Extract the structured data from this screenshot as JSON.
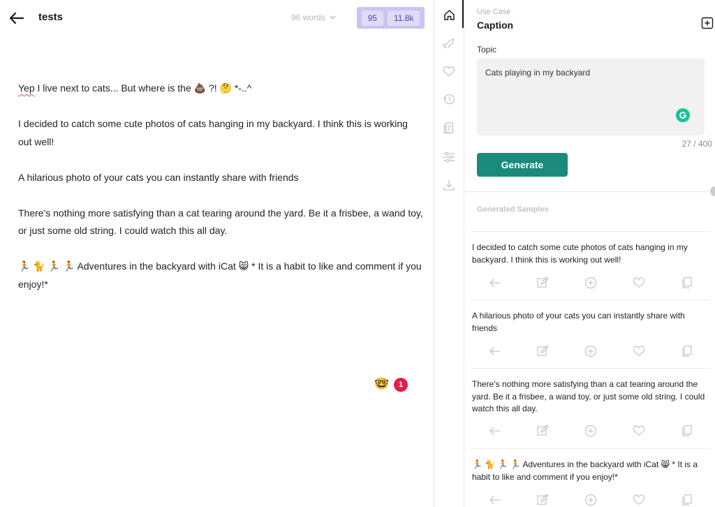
{
  "editor": {
    "title": "tests",
    "word_count": "96 words",
    "score": "95",
    "chars": "11.8k",
    "paragraphs": [
      {
        "squiggle": "Yep",
        "rest": " I live next to cats... But where is the 💩 ?! 🤔 *-..^"
      },
      {
        "text": "I decided to catch some cute photos of cats hanging in my backyard. I think this is working out well!"
      },
      {
        "text": "A hilarious photo of your cats you can instantly share with friends"
      },
      {
        "text": "There's nothing more satisfying than a cat tearing around the yard. Be it a frisbee, a wand toy, or just some old string. I could watch this all day."
      },
      {
        "text": "🏃 🐈 🏃 🏃 Adventures in the backyard with iCat 😸 * It is a habit to like and comment if you enjoy!*"
      }
    ],
    "float_emoji": "🤓",
    "alert_count": "1"
  },
  "rail": {
    "items": [
      "home-icon",
      "rocket-icon",
      "heart-icon",
      "history-icon",
      "document-icon",
      "sliders-icon",
      "download-icon"
    ]
  },
  "panel": {
    "use_case_label": "Use Case",
    "use_case_value": "Caption",
    "topic_label": "Topic",
    "topic_value": "Cats playing in my backyard",
    "char_count": "27 / 400",
    "generate_label": "Generate",
    "generated_label": "Generated Samples",
    "samples": [
      "I decided to catch some cute photos of cats hanging in my backyard. I think this is working out well!",
      "A hilarious photo of your cats you can instantly share with friends",
      "There's nothing more satisfying than a cat tearing around the yard. Be it a frisbee, a wand toy, or just some old string. I could watch this all day.",
      "🏃 🐈 🏃 🏃 Adventures in the backyard with iCat 😸 * It is a habit to like and comment if you enjoy!*"
    ]
  },
  "colors": {
    "accent": "#1a8a7c",
    "score_bg": "#c9c4f2",
    "alert": "#e11d48"
  }
}
